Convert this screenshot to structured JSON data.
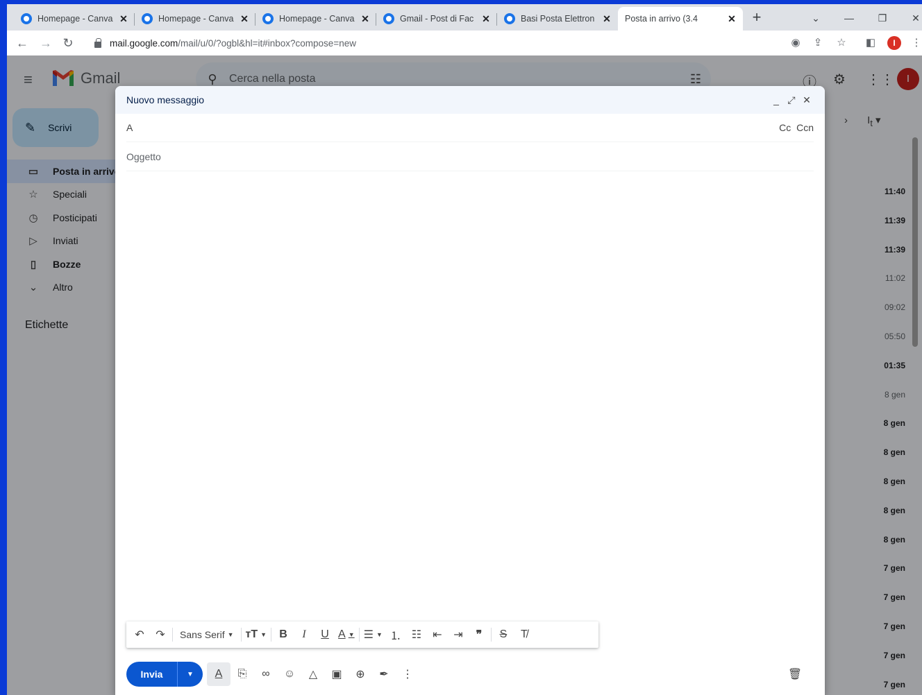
{
  "browser": {
    "tabs": [
      {
        "title": "Homepage - Canva",
        "icon": "canva-icon",
        "active": false
      },
      {
        "title": "Homepage - Canva",
        "icon": "canva-icon",
        "active": false
      },
      {
        "title": "Homepage - Canva",
        "icon": "canva-icon",
        "active": false
      },
      {
        "title": "Gmail - Post di Fac",
        "icon": "canva-icon",
        "active": false
      },
      {
        "title": "Basi Posta Elettron",
        "icon": "canva-icon",
        "active": false
      },
      {
        "title": "Posta in arrivo (3.4",
        "icon": "gmail-icon",
        "active": true
      }
    ],
    "tab_close": "✕",
    "new_tab": "+",
    "url_host": "mail.google.com",
    "url_path": "/mail/u/0/?ogbl&hl=it#inbox?compose=new",
    "profile_initial": "I"
  },
  "gmail": {
    "app_name": "Gmail",
    "search_placeholder": "Cerca nella posta",
    "compose_label": "Scrivi",
    "nav": [
      {
        "label": "Posta in arrivo",
        "icon": "inbox-icon"
      },
      {
        "label": "Speciali",
        "icon": "star-icon"
      },
      {
        "label": "Posticipati",
        "icon": "clock-icon"
      },
      {
        "label": "Inviati",
        "icon": "send-icon"
      },
      {
        "label": "Bozze",
        "icon": "draft-icon"
      },
      {
        "label": "Altro",
        "icon": "chevron-down-icon"
      }
    ],
    "labels_heading": "Etichette",
    "avatar_initial": "I",
    "times": [
      "11:40",
      "11:39",
      "11:39",
      "11:02",
      "09:02",
      "05:50",
      "01:35",
      "8 gen",
      "8 gen",
      "8 gen",
      "8 gen",
      "8 gen",
      "8 gen",
      "7 gen",
      "7 gen",
      "7 gen",
      "7 gen",
      "7 gen"
    ],
    "read_rows": [
      3,
      4,
      5,
      7
    ]
  },
  "compose": {
    "title": "Nuovo messaggio",
    "to_label": "A",
    "to_value": "",
    "cc_label": "Cc",
    "bcc_label": "Ccn",
    "subject_placeholder": "Oggetto",
    "font_name": "Sans Serif",
    "send_label": "Invia"
  },
  "colors": {
    "send_button": "#0b57d0",
    "compose_header": "#f2f6fc",
    "desktop_background": "#0b3bd6"
  }
}
